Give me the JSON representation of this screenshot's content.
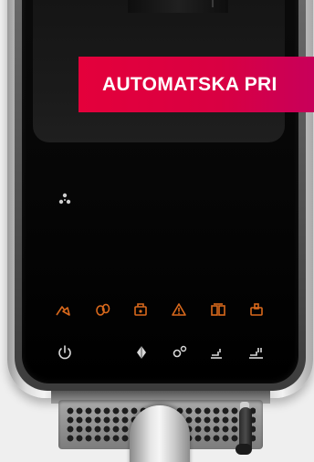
{
  "banner": {
    "text": "AUTOMATSKA PRI"
  },
  "colors": {
    "banner": "#e4003b",
    "warning_icons": "#d9691c",
    "status_icons": "#d8d8d8"
  },
  "warning_icons": [
    "water-tank-icon",
    "coffee-beans-icon",
    "grounds-container-icon",
    "warning-triangle-icon",
    "descale-icon",
    "drip-tray-icon"
  ],
  "control_icons": [
    "power-icon",
    "aroma-icon",
    "settings-icon",
    "single-cup-icon",
    "double-cup-icon"
  ]
}
